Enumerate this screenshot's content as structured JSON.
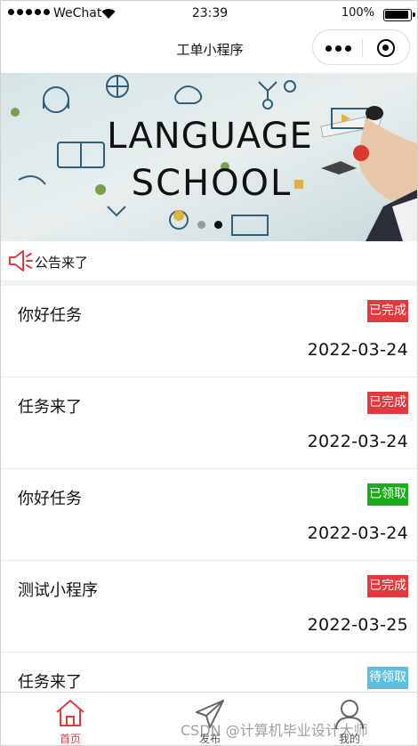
{
  "status_bar": {
    "carrier": "WeChat",
    "time": "23:39",
    "battery": "100%"
  },
  "nav": {
    "title": "工单小程序"
  },
  "banner": {
    "headline_line1": "LANGUAGE",
    "headline_line2": "SCHOOL",
    "slide_count": 2,
    "active_slide": 2
  },
  "notice": {
    "text": "公告来了"
  },
  "colors": {
    "completed": "#e0393e",
    "claimed": "#1aad19",
    "pending": "#5bc0de",
    "tab_active": "#e0393e",
    "tab_inactive": "#555555"
  },
  "tasks": [
    {
      "title": "你好任务",
      "status": "已完成",
      "status_color": "#e0393e",
      "date": "2022-03-24"
    },
    {
      "title": "任务来了",
      "status": "已完成",
      "status_color": "#e0393e",
      "date": "2022-03-24"
    },
    {
      "title": "你好任务",
      "status": "已领取",
      "status_color": "#1aad19",
      "date": "2022-03-24"
    },
    {
      "title": "测试小程序",
      "status": "已完成",
      "status_color": "#e0393e",
      "date": "2022-03-25"
    },
    {
      "title": "任务来了",
      "status": "待领取",
      "status_color": "#5bc0de",
      "date": ""
    }
  ],
  "tabs": [
    {
      "label": "首页",
      "icon": "home-icon",
      "active": true
    },
    {
      "label": "发布",
      "icon": "send-icon",
      "active": false
    },
    {
      "label": "我的",
      "icon": "user-icon",
      "active": false
    }
  ],
  "watermark": "CSDN @计算机毕业设计大师"
}
